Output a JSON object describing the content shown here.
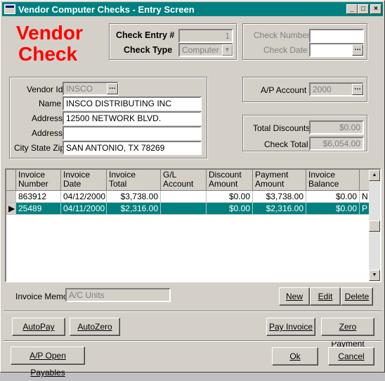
{
  "window": {
    "title": "Vendor Computer Checks - Entry Screen"
  },
  "brand": {
    "line1": "Vendor",
    "line2": "Check"
  },
  "check_entry": {
    "entry_label": "Check Entry #",
    "entry_value": "1",
    "type_label": "Check Type",
    "type_value": "Computer"
  },
  "check_info": {
    "number_label": "Check Number",
    "number_value": "",
    "date_label": "Check Date",
    "date_value": ""
  },
  "vendor": {
    "id_label": "Vendor Id",
    "id_value": "INSCO",
    "name_label": "Name",
    "name_value": "INSCO DISTRIBUTING INC",
    "address_label": "Address",
    "address1_value": "12500 NETWORK BLVD.",
    "address2_label": "Address",
    "address2_value": "",
    "csz_label": "City State Zip",
    "csz_value": "SAN ANTONIO, TX 78269"
  },
  "ap": {
    "label": "A/P Account",
    "value": "2000"
  },
  "totals": {
    "discounts_label": "Total Discounts",
    "discounts_value": "$0.00",
    "check_total_label": "Check Total",
    "check_total_value": "$6,054.00"
  },
  "grid": {
    "columns": [
      "Invoice\nNumber",
      "Invoice\nDate",
      "Invoice\nTotal",
      "G/L\nAccount",
      "Discount\nAmount",
      "Payment\nAmount",
      "Invoice\nBalance",
      ""
    ],
    "rows": [
      {
        "number": "863912",
        "date": "04/12/2000",
        "total": "$3,738.00",
        "gl": "",
        "discount": "$0.00",
        "payment": "$3,738.00",
        "balance": "$0.00",
        "flag": "N",
        "selected": false
      },
      {
        "number": "25489",
        "date": "04/11/2000",
        "total": "$2,316.00",
        "gl": "",
        "discount": "$0.00",
        "payment": "$2,316.00",
        "balance": "$0.00",
        "flag": "P",
        "selected": true
      }
    ]
  },
  "memo": {
    "label": "Invoice Memo",
    "value": "A/C Units"
  },
  "buttons": {
    "new": "New",
    "edit": "Edit",
    "delete": "Delete",
    "autopay": "AutoPay",
    "autozero": "AutoZero",
    "pay_invoice": "Pay Invoice",
    "zero_payment": "Zero Payment",
    "ap_open": "A/P Open Payables",
    "ok": "Ok",
    "cancel": "Cancel"
  },
  "colors": {
    "title_bar": "#008080",
    "selected_row": "#008080",
    "brand": "#ff0000"
  }
}
